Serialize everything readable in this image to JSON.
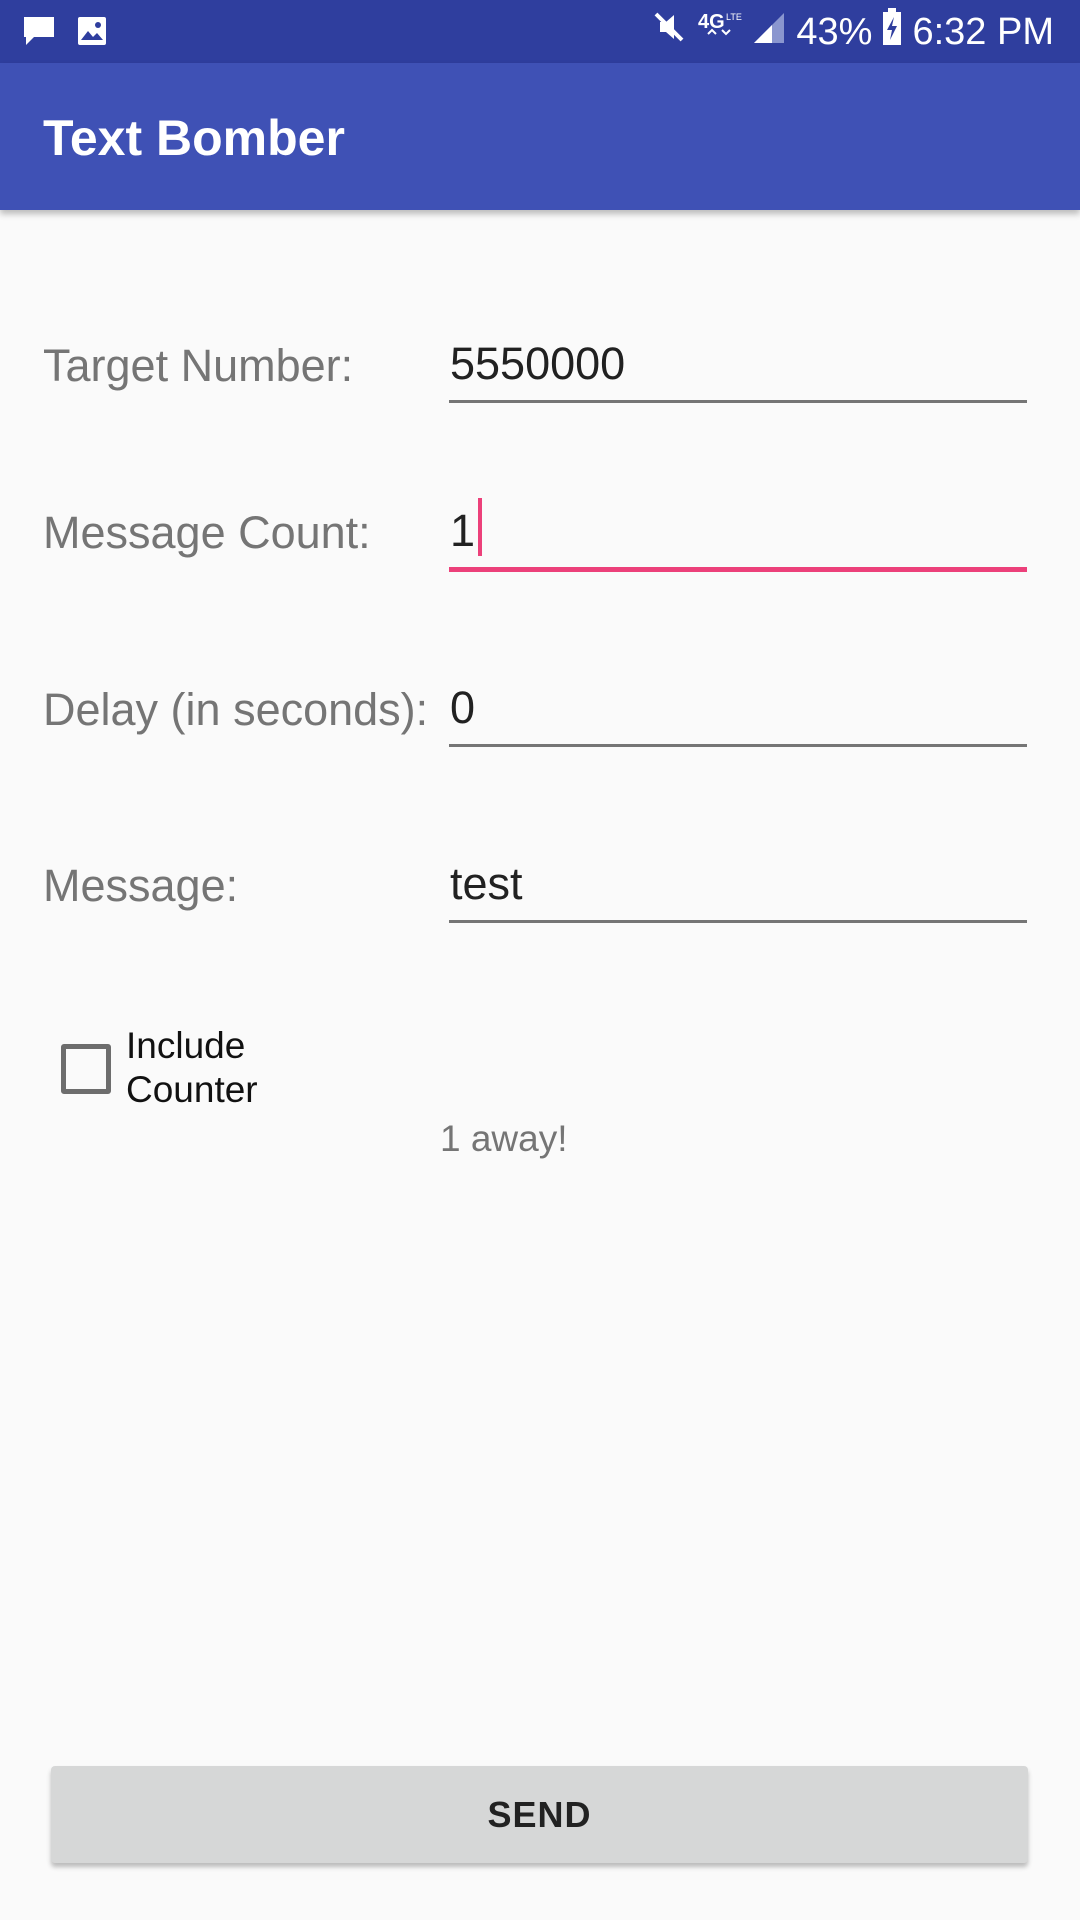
{
  "status_bar": {
    "left_icons": [
      "message-icon",
      "image-icon"
    ],
    "right_icons": [
      "mute-icon",
      "4g-lte-icon",
      "signal-icon",
      "battery-charging-icon"
    ],
    "battery_percent": "43%",
    "time": "6:32 PM",
    "color": "#2f3e9e"
  },
  "app_bar": {
    "title": "Text Bomber",
    "color": "#3f51b5"
  },
  "form": {
    "target_number": {
      "label": "Target Number:",
      "value": "5550000"
    },
    "message_count": {
      "label": "Message Count:",
      "value": "1",
      "focused": true
    },
    "delay": {
      "label": "Delay (in seconds):",
      "value": "0"
    },
    "message": {
      "label": "Message:",
      "value": "test"
    }
  },
  "include_counter": {
    "label_line1": "Include",
    "label_line2": "Counter",
    "checked": false
  },
  "status_text": "1 away!",
  "send_button": {
    "label": "SEND"
  },
  "accent_color": "#ec407a"
}
